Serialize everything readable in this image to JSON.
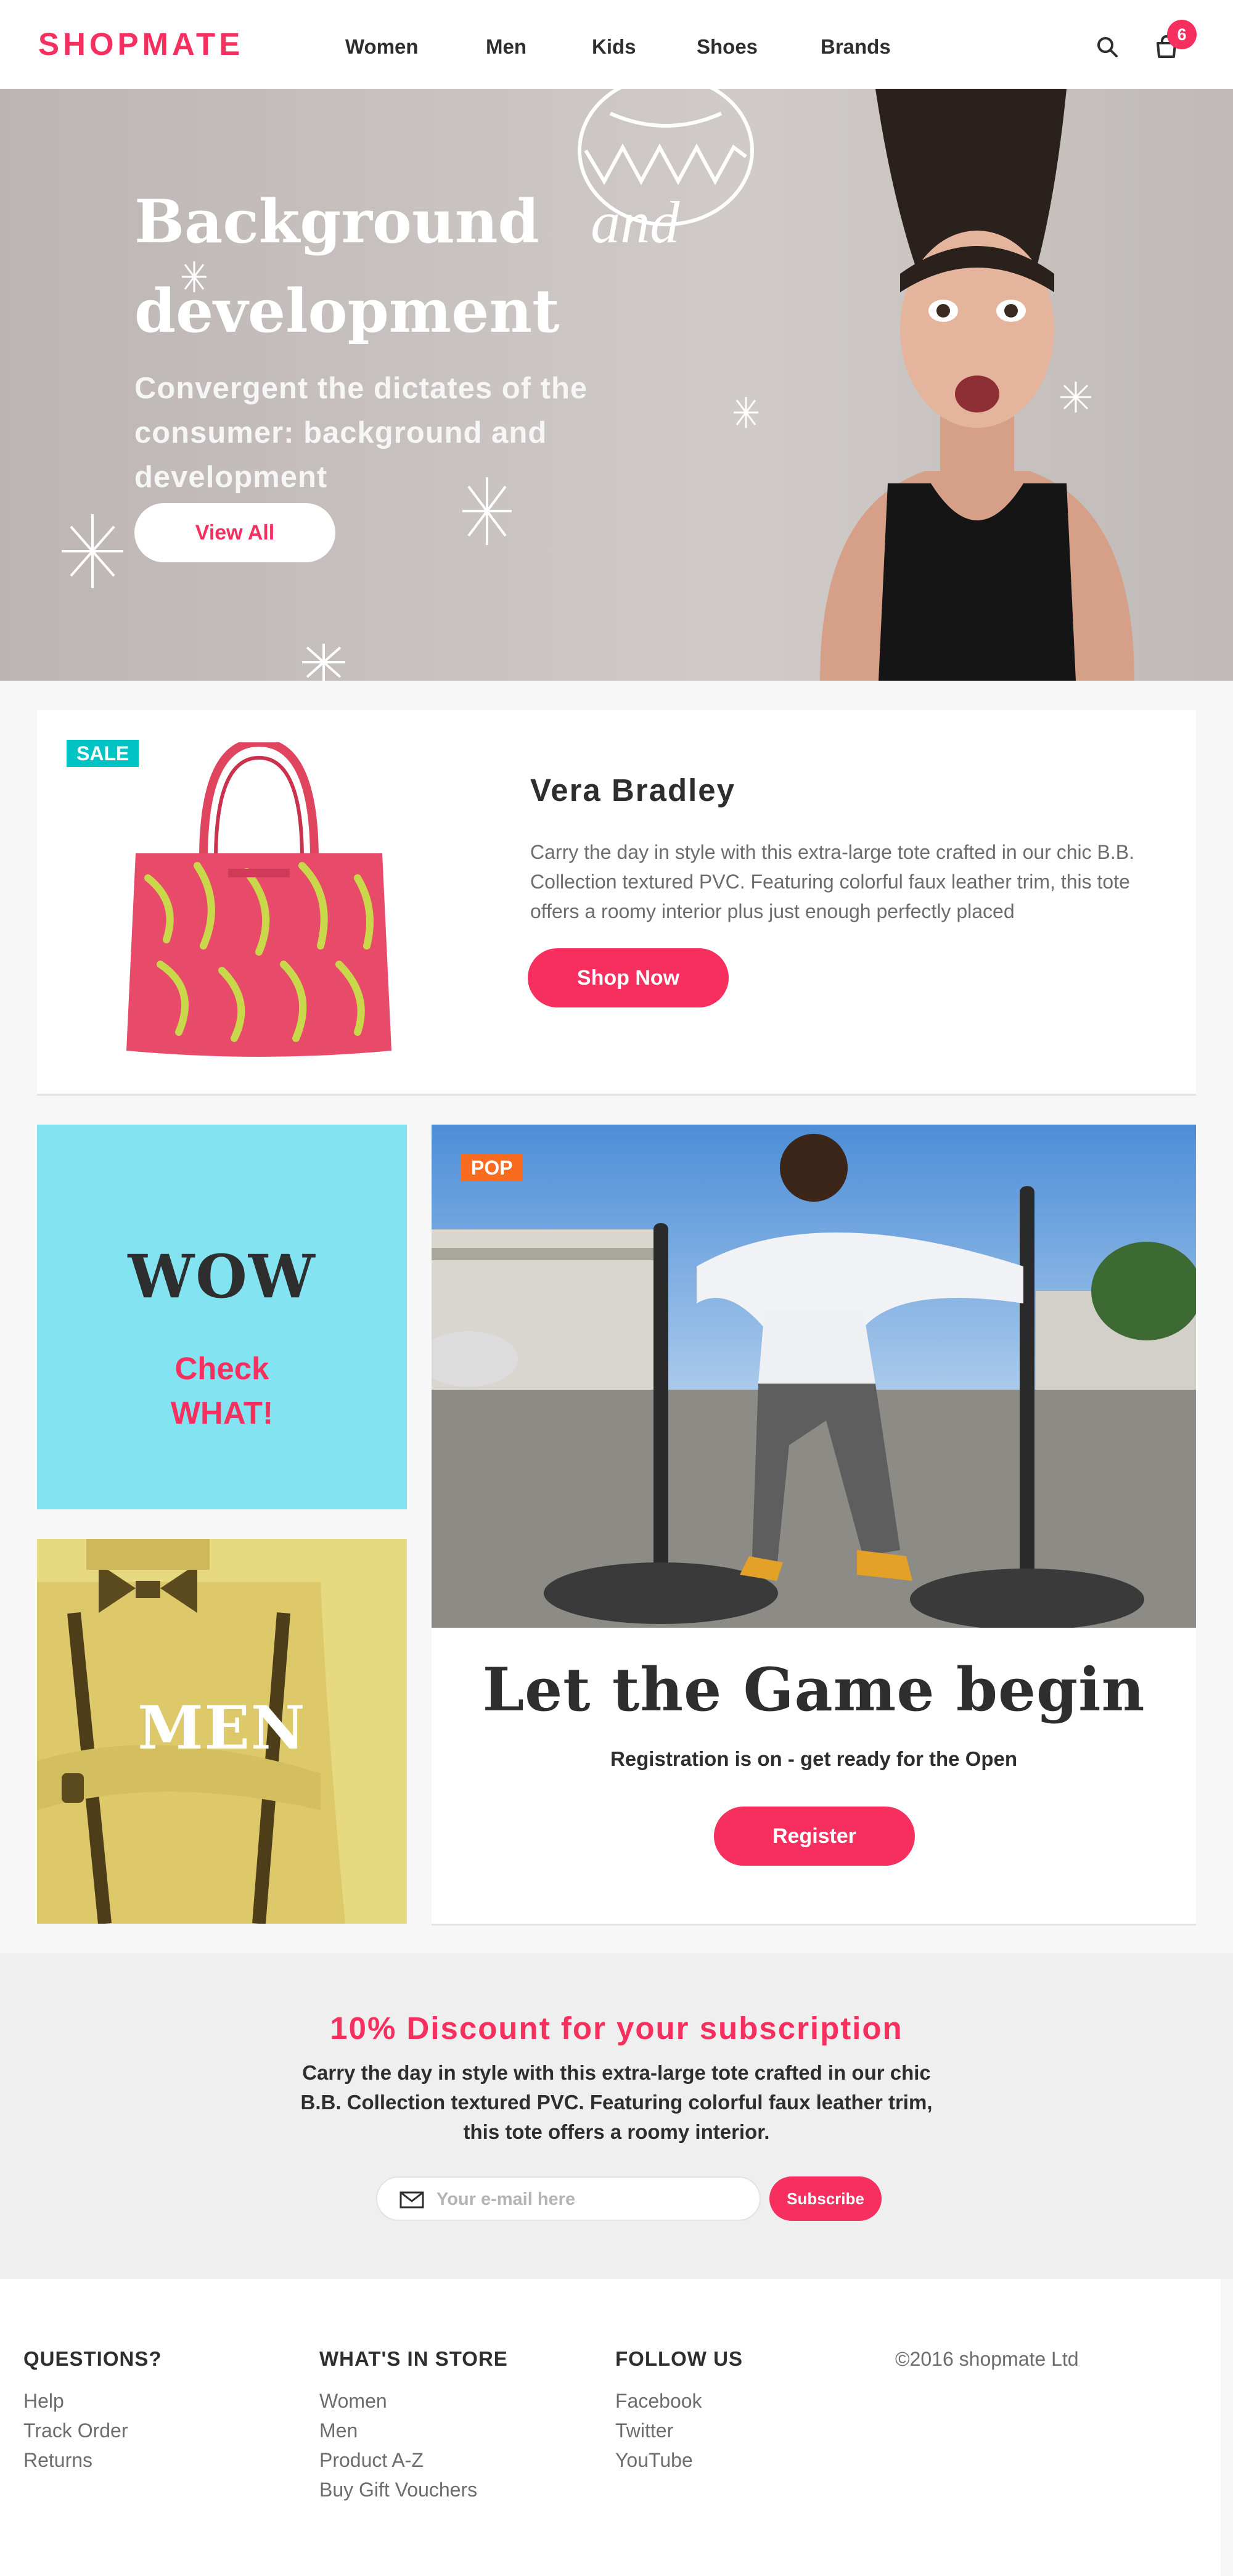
{
  "header": {
    "logo": "SHOPMATE",
    "nav": [
      "Women",
      "Men",
      "Kids",
      "Shoes",
      "Brands"
    ],
    "cart_count": "6",
    "icons": [
      "search-icon",
      "bag-icon"
    ]
  },
  "hero": {
    "title_line1": "Background",
    "title_italic": "and",
    "title_line2": "development",
    "subtitle": "Convergent the dictates of the consumer: background and development",
    "button": "View All"
  },
  "product": {
    "badge": "SALE",
    "title": "Vera Bradley",
    "description": "Carry the day in style with this extra-large tote crafted in our chic B.B. Collection textured PVC. Featuring colorful faux leather trim, this tote offers a roomy interior plus just enough perfectly placed",
    "button": "Shop Now"
  },
  "wow_tile": {
    "title": "WOW",
    "subtitle_line1": "Check",
    "subtitle_line2": "WHAT!"
  },
  "men_tile": {
    "title": "MEN"
  },
  "game": {
    "badge": "POP",
    "title": "Let the Game begin",
    "subtitle": "Registration is on - get ready for the Open",
    "button": "Register"
  },
  "subscribe": {
    "title": "10% Discount for your subscription",
    "description": "Carry the day in style with this extra-large tote crafted in our chic B.B. Collection textured PVC. Featuring colorful faux leather trim, this tote offers a roomy interior.",
    "email_placeholder": "Your e-mail here",
    "button": "Subscribe"
  },
  "footer": {
    "questions": {
      "heading": "QUESTIONS?",
      "links": [
        "Help",
        "Track Order",
        "Returns"
      ]
    },
    "store": {
      "heading": "WHAT'S IN STORE",
      "links": [
        "Women",
        "Men",
        "Product A-Z",
        "Buy Gift Vouchers"
      ]
    },
    "follow": {
      "heading": "FOLLOW US",
      "links": [
        "Facebook",
        "Twitter",
        "YouTube"
      ]
    },
    "copyright": "©2016 shopmate Ltd"
  },
  "colors": {
    "accent": "#f62f5e",
    "sale_badge": "#00c3c3",
    "pop_badge": "#f96b1e",
    "wow_bg": "#84e3f1",
    "men_bg": "#e7d980"
  }
}
